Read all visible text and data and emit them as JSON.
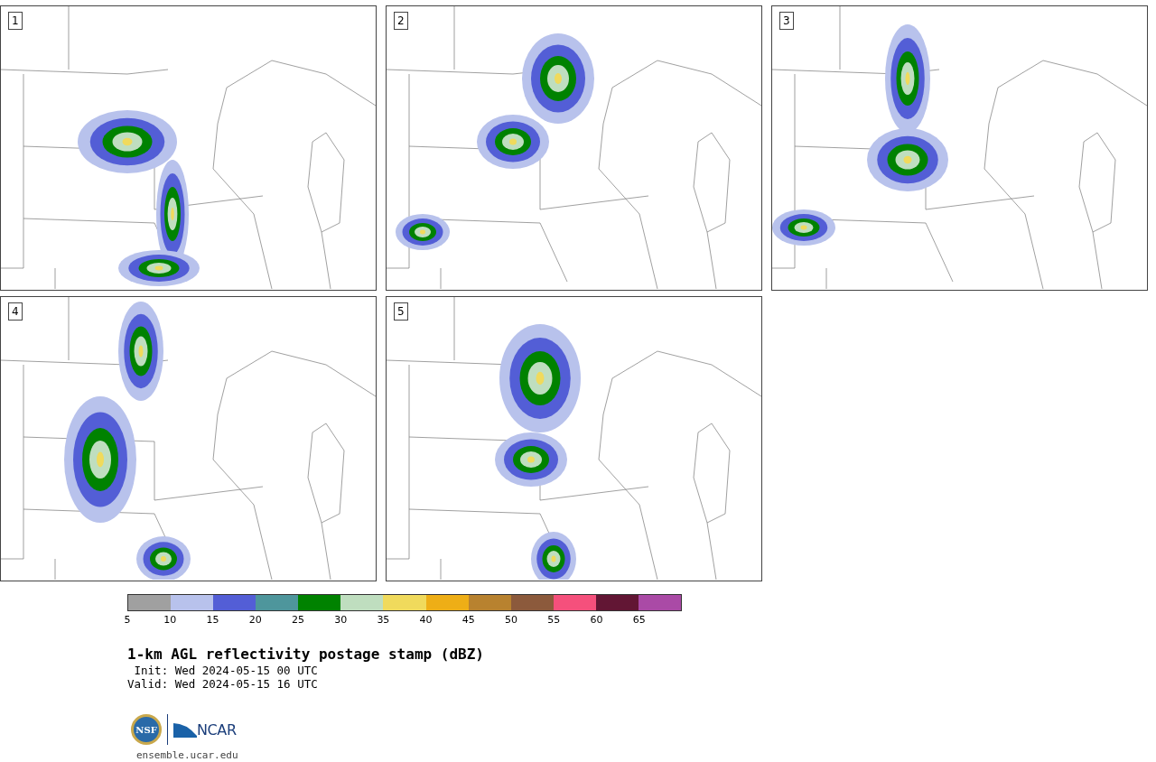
{
  "panels": [
    {
      "label": "1"
    },
    {
      "label": "2"
    },
    {
      "label": "3"
    },
    {
      "label": "4"
    },
    {
      "label": "5"
    }
  ],
  "colorbar": [
    {
      "label": "5",
      "color": "#a0a0a0"
    },
    {
      "label": "10",
      "color": "#b8c2ec"
    },
    {
      "label": "15",
      "color": "#535ed6"
    },
    {
      "label": "20",
      "color": "#4e969c"
    },
    {
      "label": "25",
      "color": "#008200"
    },
    {
      "label": "30",
      "color": "#bfdebf"
    },
    {
      "label": "35",
      "color": "#f0da5c"
    },
    {
      "label": "40",
      "color": "#eeae16"
    },
    {
      "label": "45",
      "color": "#b8822f"
    },
    {
      "label": "50",
      "color": "#8c5a3c"
    },
    {
      "label": "55",
      "color": "#f5507c"
    },
    {
      "label": "60",
      "color": "#621634"
    },
    {
      "label": "65",
      "color": "#aa4aa6"
    }
  ],
  "title": "1-km AGL reflectivity postage stamp (dBZ)",
  "init": " Init: Wed 2024-05-15 00 UTC",
  "valid": "Valid: Wed 2024-05-15 16 UTC",
  "logo": {
    "nsf": "NSF",
    "ncar": "NCAR"
  },
  "site": "ensemble.ucar.edu"
}
